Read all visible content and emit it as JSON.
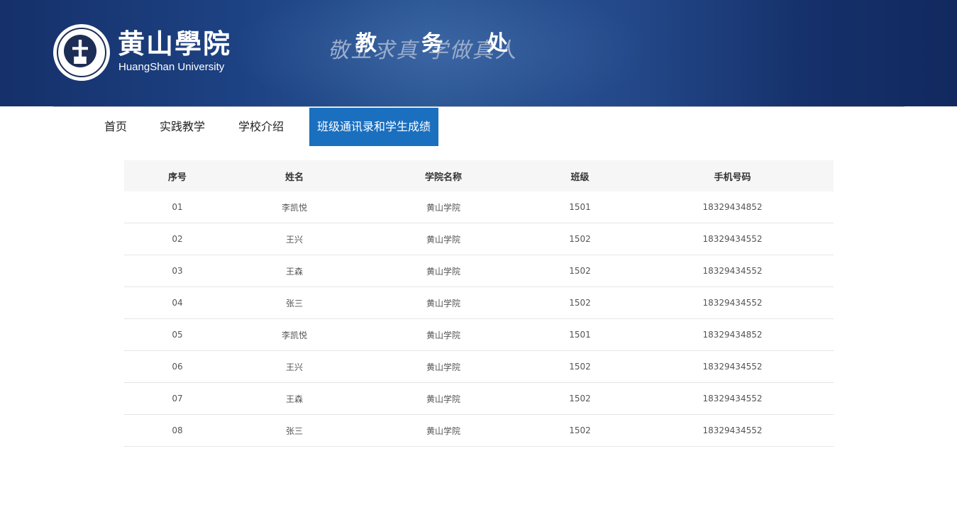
{
  "header": {
    "brand_cn": "黄山學院",
    "brand_en": "HuangShan University",
    "motto": "敬业求真 学做真人",
    "office_chars": [
      "教",
      "务",
      "处"
    ]
  },
  "nav": {
    "items": [
      {
        "label": "首页",
        "active": false
      },
      {
        "label": "实践教学",
        "active": false
      },
      {
        "label": "学校介绍",
        "active": false
      },
      {
        "label": "班级通讯录和学生成绩",
        "active": true
      }
    ]
  },
  "table": {
    "columns": [
      "序号",
      "姓名",
      "学院名称",
      "班级",
      "手机号码"
    ],
    "rows": [
      [
        "01",
        "李凯悦",
        "黄山学院",
        "1501",
        "18329434852"
      ],
      [
        "02",
        "王兴",
        "黄山学院",
        "1502",
        "18329434552"
      ],
      [
        "03",
        "王森",
        "黄山学院",
        "1502",
        "18329434552"
      ],
      [
        "04",
        "张三",
        "黄山学院",
        "1502",
        "18329434552"
      ],
      [
        "05",
        "李凯悦",
        "黄山学院",
        "1501",
        "18329434852"
      ],
      [
        "06",
        "王兴",
        "黄山学院",
        "1502",
        "18329434552"
      ],
      [
        "07",
        "王森",
        "黄山学院",
        "1502",
        "18329434552"
      ],
      [
        "08",
        "张三",
        "黄山学院",
        "1502",
        "18329434552"
      ]
    ]
  },
  "colors": {
    "header_dark": "#15306a",
    "header_light": "#2a5694",
    "nav_active": "#1a6fbf"
  }
}
